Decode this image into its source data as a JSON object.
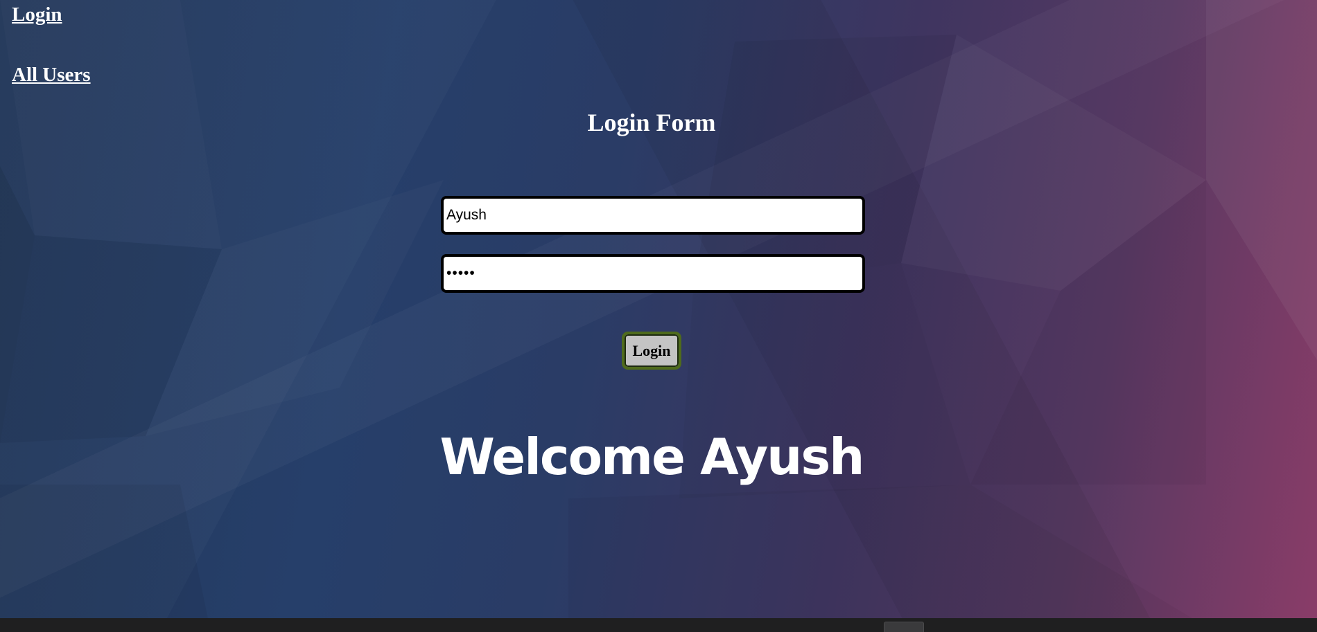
{
  "nav": {
    "login_label": "Login",
    "all_users_label": "All Users"
  },
  "form": {
    "title": "Login Form",
    "username_value": "Ayush",
    "password_value": "•••••",
    "submit_label": "Login"
  },
  "welcome": {
    "message": "Welcome Ayush"
  },
  "colors": {
    "background_start": "#223759",
    "background_end": "#8a3c68",
    "button_border": "#4f6b1c",
    "button_fill": "#c4c4c4"
  }
}
